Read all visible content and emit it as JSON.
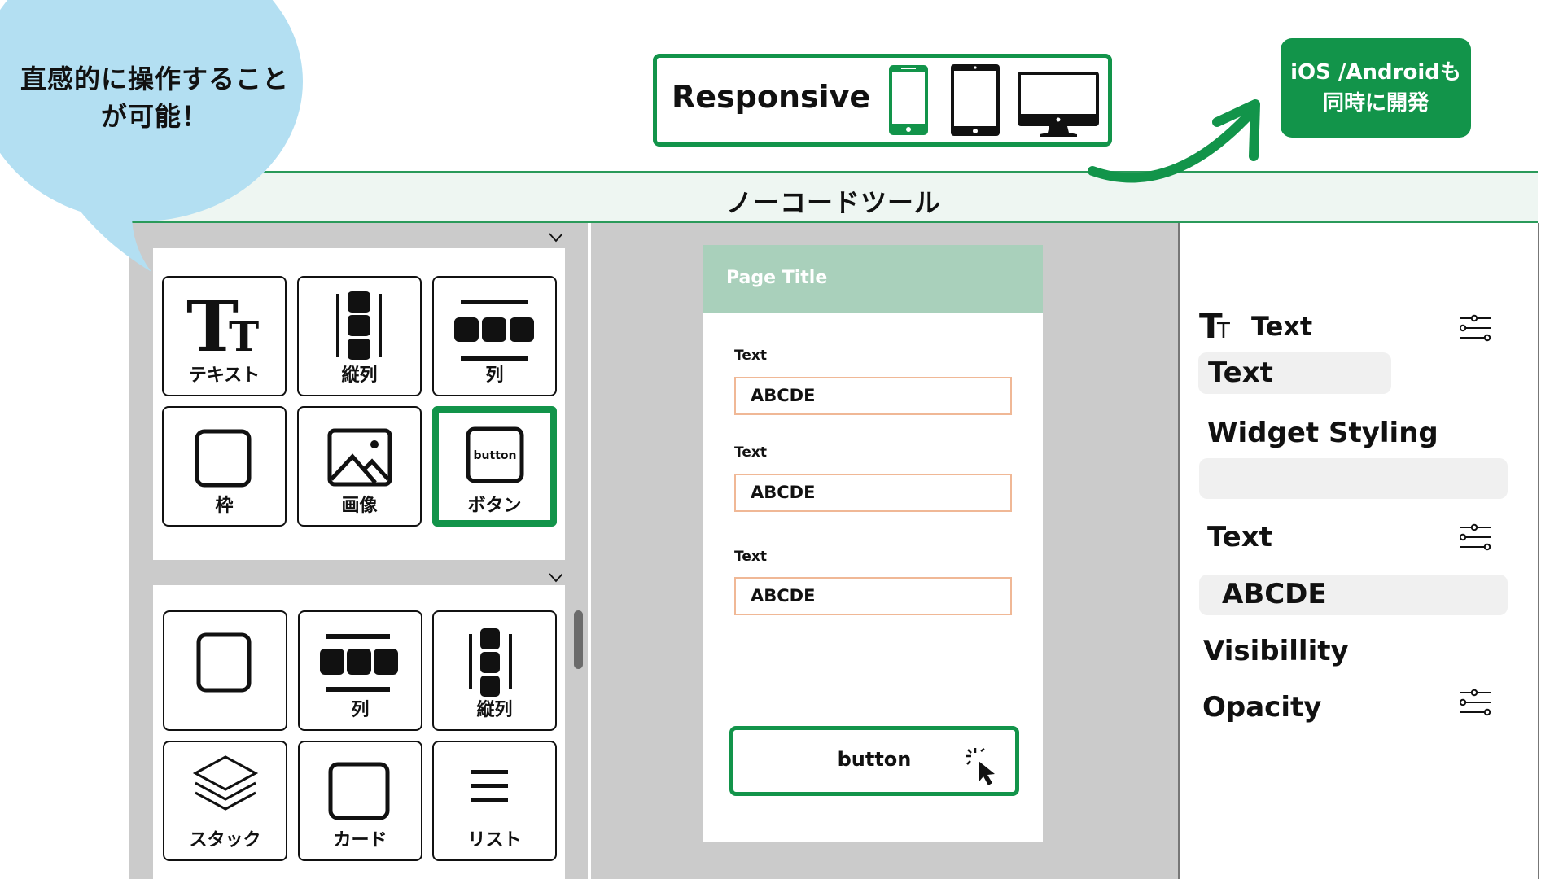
{
  "bubble": {
    "line1": "直感的に操作すること",
    "line2": "が可能！",
    "color": "#b3dff2"
  },
  "responsive": {
    "label": "Responsive",
    "devices": [
      "smartphone-icon",
      "tablet-icon",
      "desktop-icon"
    ],
    "active_device": "smartphone"
  },
  "callout": {
    "line1": "iOS /Androidも",
    "line2": "同時に開発",
    "color": "#12944a"
  },
  "header": {
    "title": "ノーコードツール"
  },
  "widget_panel": {
    "sections": [
      {
        "items": [
          {
            "label": "テキスト",
            "icon": "text-icon",
            "selected": false
          },
          {
            "label": "縦列",
            "icon": "column-icon",
            "selected": false
          },
          {
            "label": "列",
            "icon": "row-icon",
            "selected": false
          },
          {
            "label": "枠",
            "icon": "container-icon",
            "selected": false
          },
          {
            "label": "画像",
            "icon": "image-icon",
            "selected": false
          },
          {
            "label": "ボタン",
            "icon": "button-icon",
            "icon_text": "button",
            "selected": true
          }
        ]
      },
      {
        "items": [
          {
            "label": "",
            "icon": "container-icon",
            "selected": false
          },
          {
            "label": "列",
            "icon": "row-icon",
            "selected": false
          },
          {
            "label": "縦列",
            "icon": "column-icon",
            "selected": false
          },
          {
            "label": "スタック",
            "icon": "stack-icon",
            "selected": false
          },
          {
            "label": "カード",
            "icon": "card-icon",
            "selected": false
          },
          {
            "label": "リスト",
            "icon": "list-icon",
            "selected": false
          }
        ]
      }
    ]
  },
  "preview": {
    "page_title": "Page Title",
    "fields": [
      {
        "label": "Text",
        "value": "ABCDE"
      },
      {
        "label": "Text",
        "value": "ABCDE"
      },
      {
        "label": "Text",
        "value": "ABCDE"
      }
    ],
    "button_label": "button"
  },
  "properties": {
    "widget_type": "Text",
    "widget_name": "Text",
    "section_styling": "Widget Styling",
    "styling_value": "",
    "text_label": "Text",
    "text_value": "ABCDE",
    "visibility_label": "Visibillity",
    "opacity_label": "Opacity"
  }
}
